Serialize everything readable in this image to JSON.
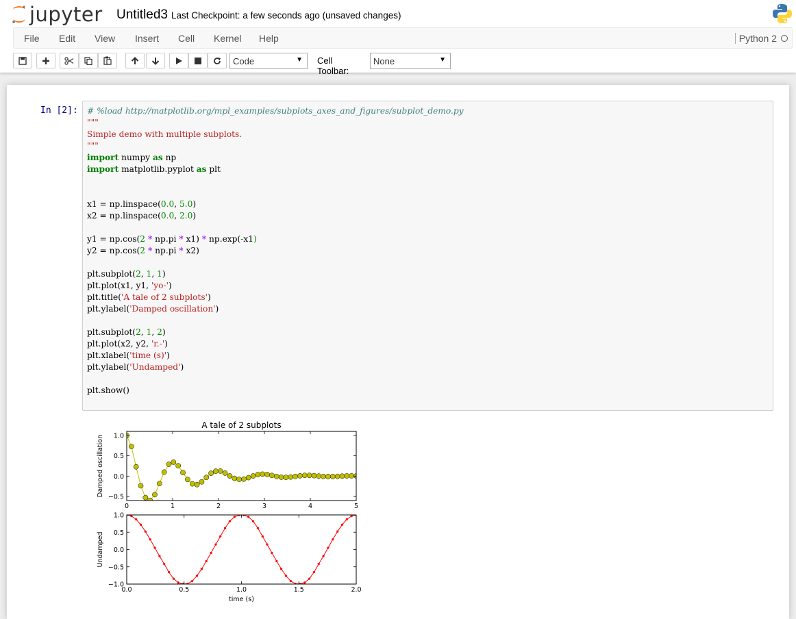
{
  "header": {
    "logo_text": "jupyter",
    "notebook_name": "Untitled3",
    "checkpoint_text": "Last Checkpoint: a few seconds ago (unsaved changes)"
  },
  "menu": {
    "items": [
      "File",
      "Edit",
      "View",
      "Insert",
      "Cell",
      "Kernel",
      "Help"
    ],
    "kernel_name": "Python 2"
  },
  "toolbar": {
    "buttons": [
      {
        "name": "save-button",
        "icon": "save-icon"
      },
      {
        "name": "insert-cell-button",
        "icon": "plus-icon"
      },
      {
        "name": "cut-button",
        "icon": "scissors-icon"
      },
      {
        "name": "copy-button",
        "icon": "copy-icon"
      },
      {
        "name": "paste-button",
        "icon": "paste-icon"
      },
      {
        "name": "move-up-button",
        "icon": "arrow-up-icon"
      },
      {
        "name": "move-down-button",
        "icon": "arrow-down-icon"
      },
      {
        "name": "run-button",
        "icon": "play-icon"
      },
      {
        "name": "interrupt-button",
        "icon": "stop-icon"
      },
      {
        "name": "restart-button",
        "icon": "refresh-icon"
      }
    ],
    "cell_type": "Code",
    "cell_toolbar_label": "Cell Toolbar:",
    "cell_toolbar_value": "None"
  },
  "cell": {
    "prompt": "In  [2]:",
    "code_lines": [
      [
        [
          "c",
          "# %load http://matplotlib.org/mpl_examples/subplots_axes_and_figures/subplot_demo.py"
        ]
      ],
      [
        [
          "s",
          "\"\"\""
        ]
      ],
      [
        [
          "s",
          "Simple demo with multiple subplots."
        ]
      ],
      [
        [
          "s",
          "\"\"\""
        ]
      ],
      [
        [
          "k",
          "import"
        ],
        [
          "t",
          " numpy "
        ],
        [
          "k",
          "as"
        ],
        [
          "t",
          " np"
        ]
      ],
      [
        [
          "k",
          "import"
        ],
        [
          "t",
          " matplotlib.pyplot "
        ],
        [
          "k",
          "as"
        ],
        [
          "t",
          " plt"
        ]
      ],
      [],
      [],
      [
        [
          "t",
          "x1 = np.linspace("
        ],
        [
          "n",
          "0.0"
        ],
        [
          "t",
          ", "
        ],
        [
          "n",
          "5.0"
        ],
        [
          "t",
          ")"
        ]
      ],
      [
        [
          "t",
          "x2 = np.linspace("
        ],
        [
          "n",
          "0.0"
        ],
        [
          "t",
          ", "
        ],
        [
          "n",
          "2.0"
        ],
        [
          "t",
          ")"
        ]
      ],
      [],
      [
        [
          "t",
          "y1 = np.cos("
        ],
        [
          "n",
          "2"
        ],
        [
          "t",
          " "
        ],
        [
          "o",
          "*"
        ],
        [
          "t",
          " np.pi "
        ],
        [
          "o",
          "*"
        ],
        [
          "t",
          " x1) "
        ],
        [
          "o",
          "*"
        ],
        [
          "t",
          " np.exp("
        ],
        [
          "g",
          "-"
        ],
        [
          "t",
          "x1"
        ],
        [
          "g",
          ")"
        ]
      ],
      [
        [
          "t",
          "y2 = np.cos("
        ],
        [
          "n",
          "2"
        ],
        [
          "t",
          " "
        ],
        [
          "o",
          "*"
        ],
        [
          "t",
          " np.pi "
        ],
        [
          "o",
          "*"
        ],
        [
          "t",
          " x2)"
        ]
      ],
      [],
      [
        [
          "t",
          "plt.subplot("
        ],
        [
          "n",
          "2"
        ],
        [
          "t",
          ", "
        ],
        [
          "n",
          "1"
        ],
        [
          "t",
          ", "
        ],
        [
          "n",
          "1"
        ],
        [
          "t",
          ")"
        ]
      ],
      [
        [
          "t",
          "plt.plot(x1, y1, "
        ],
        [
          "s",
          "'yo-'"
        ],
        [
          "t",
          ")"
        ]
      ],
      [
        [
          "t",
          "plt.title("
        ],
        [
          "s",
          "'A tale of 2 subplots'"
        ],
        [
          "t",
          ")"
        ]
      ],
      [
        [
          "t",
          "plt.ylabel("
        ],
        [
          "s",
          "'Damped oscillation'"
        ],
        [
          "t",
          ")"
        ]
      ],
      [],
      [
        [
          "t",
          "plt.subplot("
        ],
        [
          "n",
          "2"
        ],
        [
          "t",
          ", "
        ],
        [
          "n",
          "1"
        ],
        [
          "t",
          ", "
        ],
        [
          "n",
          "2"
        ],
        [
          "t",
          ")"
        ]
      ],
      [
        [
          "t",
          "plt.plot(x2, y2, "
        ],
        [
          "s",
          "'r.-'"
        ],
        [
          "t",
          ")"
        ]
      ],
      [
        [
          "t",
          "plt.xlabel("
        ],
        [
          "s",
          "'time (s)'"
        ],
        [
          "t",
          ")"
        ]
      ],
      [
        [
          "t",
          "plt.ylabel("
        ],
        [
          "s",
          "'Undamped'"
        ],
        [
          "t",
          ")"
        ]
      ],
      [],
      [
        [
          "t",
          "plt.show()"
        ]
      ]
    ]
  },
  "chart_data": [
    {
      "type": "line",
      "title": "A tale of 2 subplots",
      "xlabel": "",
      "ylabel": "Damped oscillation",
      "xlim": [
        0,
        5
      ],
      "ylim": [
        -0.6,
        1.1
      ],
      "xticks": [
        "0",
        "1",
        "2",
        "3",
        "4",
        "5"
      ],
      "yticks": [
        "-0.5",
        "0.0",
        "0.5",
        "1.0"
      ],
      "series": [
        {
          "color": "#bfbf00",
          "marker": "circle",
          "x": [
            0.0,
            0.102,
            0.204,
            0.306,
            0.408,
            0.51,
            0.612,
            0.714,
            0.816,
            0.918,
            1.02,
            1.122,
            1.224,
            1.327,
            1.429,
            1.531,
            1.633,
            1.735,
            1.837,
            1.939,
            2.041,
            2.143,
            2.245,
            2.347,
            2.449,
            2.551,
            2.653,
            2.755,
            2.857,
            2.959,
            3.061,
            3.163,
            3.265,
            3.367,
            3.469,
            3.571,
            3.673,
            3.776,
            3.878,
            3.98,
            4.082,
            4.184,
            4.286,
            4.388,
            4.49,
            4.592,
            4.694,
            4.796,
            4.898,
            5.0
          ],
          "y": [
            1.0,
            0.728,
            0.23,
            -0.237,
            -0.527,
            -0.595,
            -0.455,
            -0.182,
            0.1,
            0.292,
            0.343,
            0.256,
            0.087,
            -0.082,
            -0.19,
            -0.208,
            -0.141,
            -0.032,
            0.071,
            0.122,
            0.125,
            0.075,
            0.006,
            -0.054,
            -0.078,
            -0.073,
            -0.037,
            0.005,
            0.039,
            0.049,
            0.042,
            0.017,
            -0.008,
            -0.027,
            -0.03,
            -0.023,
            -0.007,
            0.008,
            0.018,
            0.019,
            0.012,
            0.002,
            -0.007,
            -0.011,
            -0.01,
            -0.005,
            0.001,
            0.006,
            0.007,
            0.006
          ]
        }
      ]
    },
    {
      "type": "line",
      "title": "",
      "xlabel": "time (s)",
      "ylabel": "Undamped",
      "xlim": [
        0,
        2
      ],
      "ylim": [
        -1,
        1
      ],
      "xticks": [
        "0.0",
        "0.5",
        "1.0",
        "1.5",
        "2.0"
      ],
      "yticks": [
        "-1.0",
        "-0.5",
        "0.0",
        "0.5",
        "1.0"
      ],
      "series": [
        {
          "color": "#ff0000",
          "marker": "point",
          "x": [
            0.0,
            0.041,
            0.082,
            0.122,
            0.163,
            0.204,
            0.245,
            0.286,
            0.327,
            0.367,
            0.408,
            0.449,
            0.49,
            0.531,
            0.571,
            0.612,
            0.653,
            0.694,
            0.735,
            0.776,
            0.816,
            0.857,
            0.898,
            0.939,
            0.98,
            1.02,
            1.061,
            1.102,
            1.143,
            1.184,
            1.224,
            1.265,
            1.306,
            1.347,
            1.388,
            1.429,
            1.469,
            1.51,
            1.551,
            1.592,
            1.633,
            1.673,
            1.714,
            1.755,
            1.796,
            1.837,
            1.878,
            1.918,
            1.959,
            2.0
          ],
          "y": [
            1.0,
            0.967,
            0.871,
            0.718,
            0.521,
            0.292,
            0.049,
            -0.193,
            -0.419,
            -0.654,
            -0.844,
            -0.958,
            -0.998,
            -0.991,
            -0.913,
            -0.761,
            -0.562,
            -0.337,
            -0.098,
            0.147,
            0.378,
            0.618,
            0.818,
            0.943,
            0.996,
            0.996,
            0.943,
            0.818,
            0.618,
            0.378,
            0.147,
            -0.098,
            -0.337,
            -0.562,
            -0.761,
            -0.913,
            -0.991,
            -0.998,
            -0.958,
            -0.844,
            -0.654,
            -0.419,
            -0.193,
            0.049,
            0.292,
            0.521,
            0.718,
            0.871,
            0.967,
            1.0
          ]
        }
      ]
    }
  ]
}
